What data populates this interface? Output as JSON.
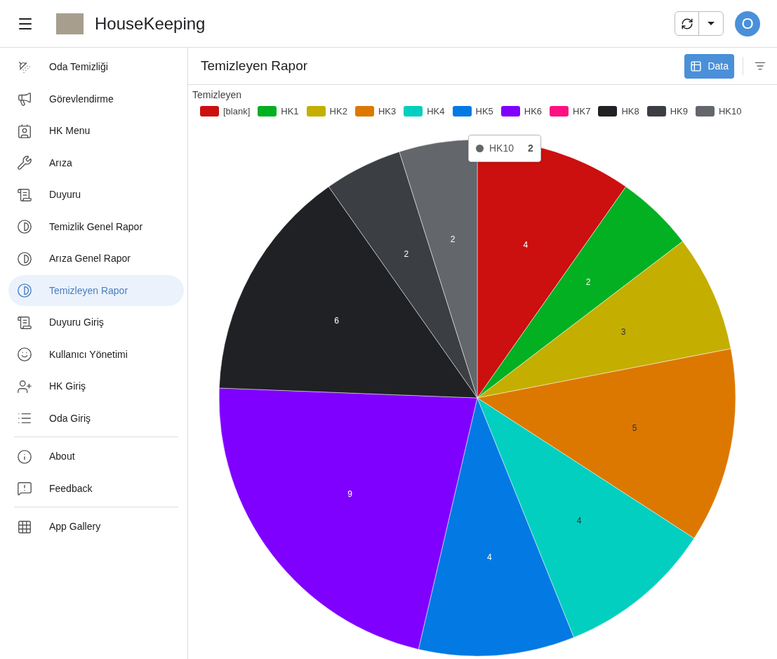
{
  "app_bar": {
    "title": "HouseKeeping",
    "avatar": "O"
  },
  "sidebar": {
    "sections": [
      {
        "items": [
          {
            "label": "Oda Temizliği",
            "selected": false
          },
          {
            "label": "Görevlendirme",
            "selected": false
          },
          {
            "label": "HK Menu",
            "selected": false
          },
          {
            "label": "Arıza",
            "selected": false
          },
          {
            "label": "Duyuru",
            "selected": false
          },
          {
            "label": "Temizlik Genel Rapor",
            "selected": false
          },
          {
            "label": "Arıza Genel Rapor",
            "selected": false
          },
          {
            "label": "Temizleyen Rapor",
            "selected": true
          },
          {
            "label": "Duyuru Giriş",
            "selected": false
          },
          {
            "label": "Kullanıcı Yönetimi",
            "selected": false
          },
          {
            "label": "HK Giriş",
            "selected": false
          },
          {
            "label": "Oda Giriş",
            "selected": false
          }
        ]
      },
      {
        "items": [
          {
            "label": "About",
            "selected": false
          },
          {
            "label": "Feedback",
            "selected": false
          }
        ]
      },
      {
        "items": [
          {
            "label": "App Gallery",
            "selected": false
          }
        ]
      }
    ]
  },
  "page": {
    "title": "Temizleyen Rapor",
    "data_button": "Data"
  },
  "chart": {
    "tooltip": {
      "label": "HK10",
      "value": "2",
      "color": "#63666b"
    },
    "chart_data": {
      "type": "pie",
      "title": "Temizleyen",
      "data_labels": true,
      "categories": [
        "[blank]",
        "HK1",
        "HK2",
        "HK3",
        "HK4",
        "HK5",
        "HK6",
        "HK7",
        "HK8",
        "HK9",
        "HK10"
      ],
      "series": [
        {
          "colors": [
            "#cc0f0f",
            "#03b022",
            "#c4ae00",
            "#dc7800",
            "#02cfbf",
            "#0379e3",
            "#8000ff",
            "#ff1080",
            "#202124",
            "#3b3e42",
            "#63666b"
          ],
          "values": [
            4,
            2,
            3,
            5,
            4,
            4,
            9,
            0,
            6,
            2,
            2
          ]
        }
      ]
    }
  }
}
